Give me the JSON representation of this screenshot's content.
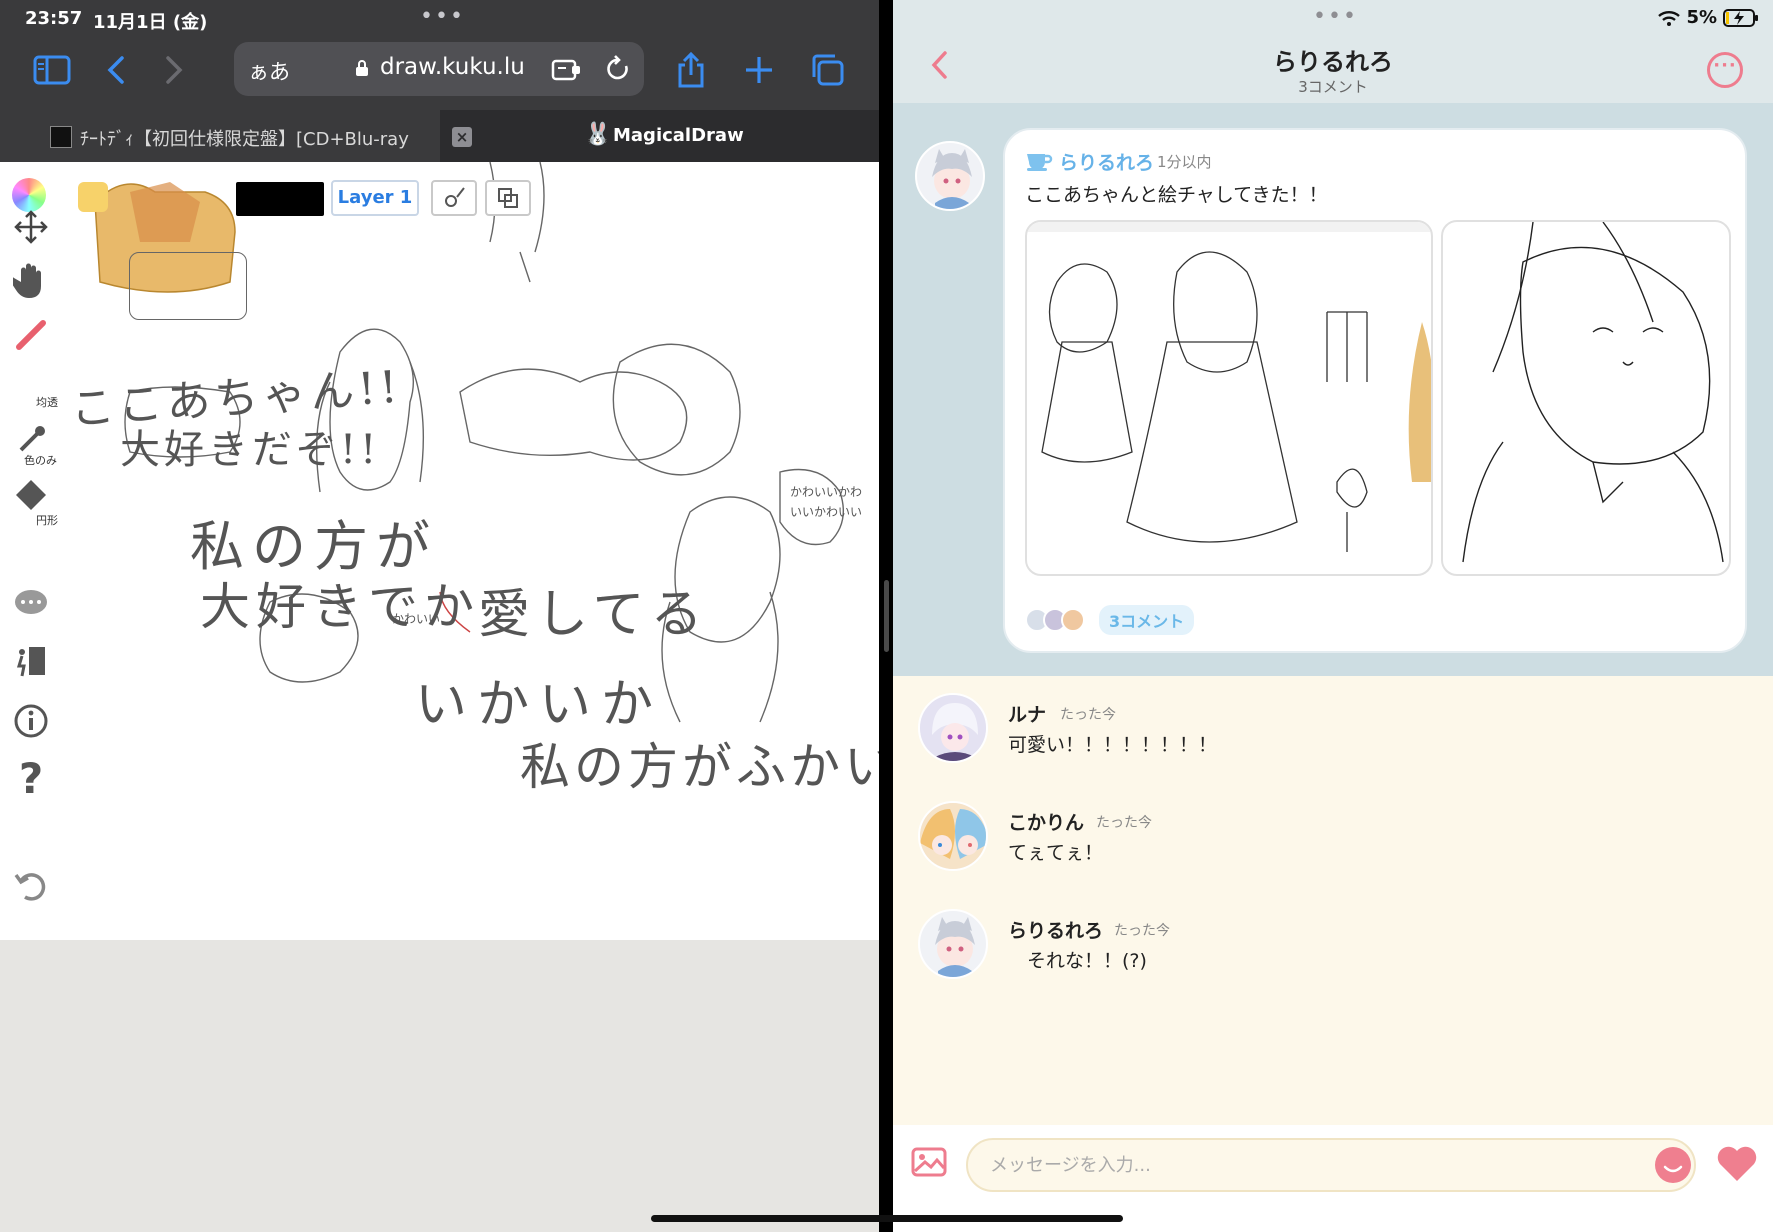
{
  "status": {
    "time": "23:57",
    "date": "11月1日 (金)",
    "battery": "5%"
  },
  "safari": {
    "address_aa": "ぁあ",
    "url": "draw.kuku.lu",
    "tabs": [
      {
        "label": "ﾁｰﾄﾃﾞｨ【初回仕様限定盤】[CD+Blu-ray…"
      },
      {
        "label": "MagicalDraw"
      }
    ]
  },
  "draw": {
    "layer_label": "Layer 1",
    "tools": {
      "pen_label": "均透",
      "eyedropper_label": "色のみ",
      "shape_label": "円形"
    },
    "colors": {
      "primary": "#f7d26a",
      "secondary": "#000000"
    },
    "sketch_texts": [
      "ここあちゃん!!",
      "大好きだぞ!!",
      "私の方が",
      "大好きでか",
      "愛してる",
      "いかいか",
      "私の方がふかい!!",
      "かわいい",
      "かわいいかわいいかわいい"
    ]
  },
  "chat": {
    "title": "らりるれろ",
    "subtitle": "3コメント",
    "post": {
      "author": "らりるれろ",
      "time": "1分以内",
      "text": "ここあちゃんと絵チャしてきた！！",
      "comment_pill": "3コメント"
    },
    "comments": [
      {
        "name": "ルナ",
        "time": "たった今",
        "text": "可愛い！！！！！！！！"
      },
      {
        "name": "こかりん",
        "time": "たった今",
        "text": "てぇてぇ！"
      },
      {
        "name": "らりるれろ",
        "time": "たった今",
        "text": "　それな！！(?)"
      }
    ],
    "composer": {
      "placeholder": "メッセージを入力..."
    },
    "accent": "#ef7f8f",
    "link": "#66b2e8"
  }
}
